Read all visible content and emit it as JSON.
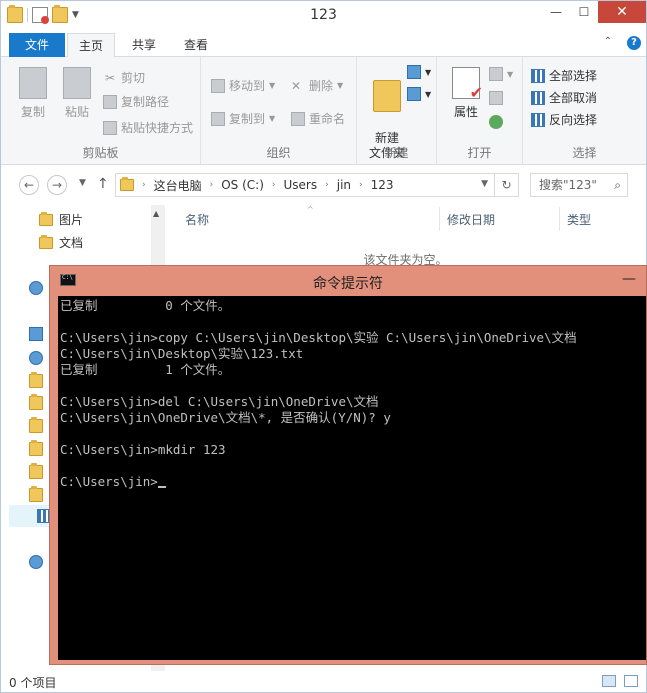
{
  "window": {
    "title": "123",
    "controls": {
      "minimize": "—",
      "maximize": "☐",
      "close": "✕"
    }
  },
  "ribbon_tabs": [
    "文件",
    "主页",
    "共享",
    "查看"
  ],
  "ribbon": {
    "clipboard": {
      "copy": "复制",
      "paste": "粘贴",
      "cut": "剪切",
      "copy_path": "复制路径",
      "paste_shortcut": "粘贴快捷方式",
      "group": "剪贴板"
    },
    "organize": {
      "move_to": "移动到",
      "copy_to": "复制到",
      "delete": "删除",
      "rename": "重命名",
      "group": "组织"
    },
    "new": {
      "new_folder": "新建\n文件夹",
      "group": "新建"
    },
    "open": {
      "properties": "属性",
      "group": "打开"
    },
    "select": {
      "select_all": "全部选择",
      "select_none": "全部取消",
      "invert": "反向选择",
      "group": "选择"
    }
  },
  "address": {
    "crumbs": [
      "这台电脑",
      "OS (C:)",
      "Users",
      "jin",
      "123"
    ],
    "search_placeholder": "搜索\"123\""
  },
  "nav_pane": {
    "items": [
      "图片",
      "文档"
    ]
  },
  "content": {
    "columns": [
      "名称",
      "修改日期",
      "类型"
    ],
    "empty_text": "该文件夹为空。"
  },
  "status": {
    "items_text": "0 个项目"
  },
  "cmd": {
    "title": "命令提示符",
    "lines": [
      "已复制         0 个文件。",
      "",
      "C:\\Users\\jin>copy C:\\Users\\jin\\Desktop\\实验 C:\\Users\\jin\\OneDrive\\文档",
      "C:\\Users\\jin\\Desktop\\实验\\123.txt",
      "已复制         1 个文件。",
      "",
      "C:\\Users\\jin>del C:\\Users\\jin\\OneDrive\\文档",
      "C:\\Users\\jin\\OneDrive\\文档\\*, 是否确认(Y/N)? y",
      "",
      "C:\\Users\\jin>mkdir 123",
      "",
      "C:\\Users\\jin>"
    ]
  }
}
